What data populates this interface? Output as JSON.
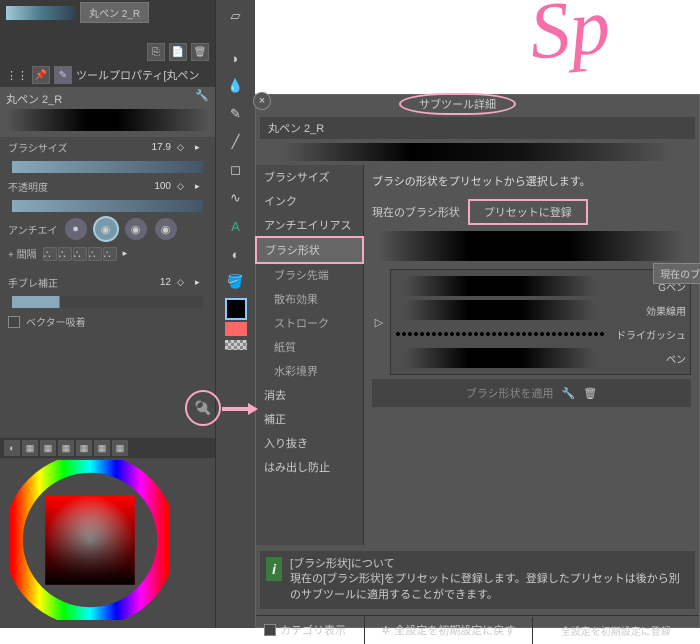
{
  "left": {
    "tool_tab": "丸ペン 2_R",
    "prop_header": "ツールプロパティ[丸ペン",
    "prop_name": "丸ペン 2_R",
    "brush_size_label": "ブラシサイズ",
    "brush_size_value": "17.9",
    "opacity_label": "不透明度",
    "opacity_value": "100",
    "antialias_label": "アンチエイ",
    "spacing_label": "+ 間隔",
    "stabilize_label": "手ブレ補正",
    "stabilize_value": "12",
    "vector_snap": "ベクター吸着"
  },
  "detail": {
    "title": "サブツール詳細",
    "brush_name": "丸ペン 2_R",
    "categories": [
      "ブラシサイズ",
      "インク",
      "アンチエイリアス",
      "ブラシ形状",
      "ブラシ先端",
      "散布効果",
      "ストローク",
      "紙質",
      "水彩境界",
      "消去",
      "補正",
      "入り抜き",
      "はみ出し防止"
    ],
    "selected_category": "ブラシ形状",
    "description": "ブラシの形状をプリセットから選択します。",
    "current_label": "現在のブラシ形状",
    "register_btn": "プリセットに登録",
    "tooltip": "現在のブラシ形状",
    "presets": [
      "Gペン",
      "効果線用",
      "ドライガッシュ",
      "ペン"
    ],
    "apply_btn": "ブラシ形状を適用",
    "info_title": "[ブラシ形状]について",
    "info_body": "現在の[ブラシ形状]をプリセットに登録します。登録したプリセットは後から別のサブツールに適用することができます。",
    "category_show": "カテゴリ表示",
    "reset_all": "全設定を初期設定に戻す",
    "save_all": "全設定を初期設定に登録",
    "expand": "▷"
  }
}
